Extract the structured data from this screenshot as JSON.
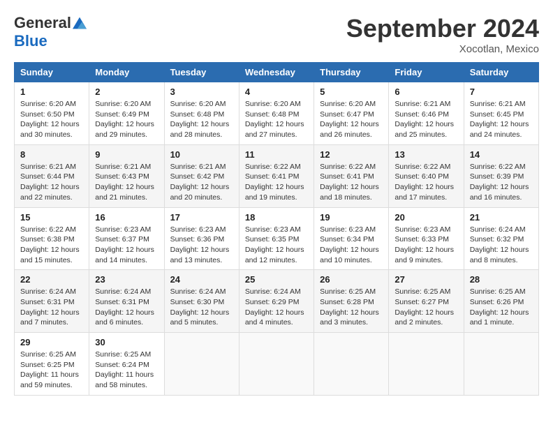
{
  "header": {
    "logo_general": "General",
    "logo_blue": "Blue",
    "month_title": "September 2024",
    "location": "Xocotlan, Mexico"
  },
  "weekdays": [
    "Sunday",
    "Monday",
    "Tuesday",
    "Wednesday",
    "Thursday",
    "Friday",
    "Saturday"
  ],
  "weeks": [
    [
      {
        "day": "1",
        "sunrise": "Sunrise: 6:20 AM",
        "sunset": "Sunset: 6:50 PM",
        "daylight": "Daylight: 12 hours and 30 minutes."
      },
      {
        "day": "2",
        "sunrise": "Sunrise: 6:20 AM",
        "sunset": "Sunset: 6:49 PM",
        "daylight": "Daylight: 12 hours and 29 minutes."
      },
      {
        "day": "3",
        "sunrise": "Sunrise: 6:20 AM",
        "sunset": "Sunset: 6:48 PM",
        "daylight": "Daylight: 12 hours and 28 minutes."
      },
      {
        "day": "4",
        "sunrise": "Sunrise: 6:20 AM",
        "sunset": "Sunset: 6:48 PM",
        "daylight": "Daylight: 12 hours and 27 minutes."
      },
      {
        "day": "5",
        "sunrise": "Sunrise: 6:20 AM",
        "sunset": "Sunset: 6:47 PM",
        "daylight": "Daylight: 12 hours and 26 minutes."
      },
      {
        "day": "6",
        "sunrise": "Sunrise: 6:21 AM",
        "sunset": "Sunset: 6:46 PM",
        "daylight": "Daylight: 12 hours and 25 minutes."
      },
      {
        "day": "7",
        "sunrise": "Sunrise: 6:21 AM",
        "sunset": "Sunset: 6:45 PM",
        "daylight": "Daylight: 12 hours and 24 minutes."
      }
    ],
    [
      {
        "day": "8",
        "sunrise": "Sunrise: 6:21 AM",
        "sunset": "Sunset: 6:44 PM",
        "daylight": "Daylight: 12 hours and 22 minutes."
      },
      {
        "day": "9",
        "sunrise": "Sunrise: 6:21 AM",
        "sunset": "Sunset: 6:43 PM",
        "daylight": "Daylight: 12 hours and 21 minutes."
      },
      {
        "day": "10",
        "sunrise": "Sunrise: 6:21 AM",
        "sunset": "Sunset: 6:42 PM",
        "daylight": "Daylight: 12 hours and 20 minutes."
      },
      {
        "day": "11",
        "sunrise": "Sunrise: 6:22 AM",
        "sunset": "Sunset: 6:41 PM",
        "daylight": "Daylight: 12 hours and 19 minutes."
      },
      {
        "day": "12",
        "sunrise": "Sunrise: 6:22 AM",
        "sunset": "Sunset: 6:41 PM",
        "daylight": "Daylight: 12 hours and 18 minutes."
      },
      {
        "day": "13",
        "sunrise": "Sunrise: 6:22 AM",
        "sunset": "Sunset: 6:40 PM",
        "daylight": "Daylight: 12 hours and 17 minutes."
      },
      {
        "day": "14",
        "sunrise": "Sunrise: 6:22 AM",
        "sunset": "Sunset: 6:39 PM",
        "daylight": "Daylight: 12 hours and 16 minutes."
      }
    ],
    [
      {
        "day": "15",
        "sunrise": "Sunrise: 6:22 AM",
        "sunset": "Sunset: 6:38 PM",
        "daylight": "Daylight: 12 hours and 15 minutes."
      },
      {
        "day": "16",
        "sunrise": "Sunrise: 6:23 AM",
        "sunset": "Sunset: 6:37 PM",
        "daylight": "Daylight: 12 hours and 14 minutes."
      },
      {
        "day": "17",
        "sunrise": "Sunrise: 6:23 AM",
        "sunset": "Sunset: 6:36 PM",
        "daylight": "Daylight: 12 hours and 13 minutes."
      },
      {
        "day": "18",
        "sunrise": "Sunrise: 6:23 AM",
        "sunset": "Sunset: 6:35 PM",
        "daylight": "Daylight: 12 hours and 12 minutes."
      },
      {
        "day": "19",
        "sunrise": "Sunrise: 6:23 AM",
        "sunset": "Sunset: 6:34 PM",
        "daylight": "Daylight: 12 hours and 10 minutes."
      },
      {
        "day": "20",
        "sunrise": "Sunrise: 6:23 AM",
        "sunset": "Sunset: 6:33 PM",
        "daylight": "Daylight: 12 hours and 9 minutes."
      },
      {
        "day": "21",
        "sunrise": "Sunrise: 6:24 AM",
        "sunset": "Sunset: 6:32 PM",
        "daylight": "Daylight: 12 hours and 8 minutes."
      }
    ],
    [
      {
        "day": "22",
        "sunrise": "Sunrise: 6:24 AM",
        "sunset": "Sunset: 6:31 PM",
        "daylight": "Daylight: 12 hours and 7 minutes."
      },
      {
        "day": "23",
        "sunrise": "Sunrise: 6:24 AM",
        "sunset": "Sunset: 6:31 PM",
        "daylight": "Daylight: 12 hours and 6 minutes."
      },
      {
        "day": "24",
        "sunrise": "Sunrise: 6:24 AM",
        "sunset": "Sunset: 6:30 PM",
        "daylight": "Daylight: 12 hours and 5 minutes."
      },
      {
        "day": "25",
        "sunrise": "Sunrise: 6:24 AM",
        "sunset": "Sunset: 6:29 PM",
        "daylight": "Daylight: 12 hours and 4 minutes."
      },
      {
        "day": "26",
        "sunrise": "Sunrise: 6:25 AM",
        "sunset": "Sunset: 6:28 PM",
        "daylight": "Daylight: 12 hours and 3 minutes."
      },
      {
        "day": "27",
        "sunrise": "Sunrise: 6:25 AM",
        "sunset": "Sunset: 6:27 PM",
        "daylight": "Daylight: 12 hours and 2 minutes."
      },
      {
        "day": "28",
        "sunrise": "Sunrise: 6:25 AM",
        "sunset": "Sunset: 6:26 PM",
        "daylight": "Daylight: 12 hours and 1 minute."
      }
    ],
    [
      {
        "day": "29",
        "sunrise": "Sunrise: 6:25 AM",
        "sunset": "Sunset: 6:25 PM",
        "daylight": "Daylight: 11 hours and 59 minutes."
      },
      {
        "day": "30",
        "sunrise": "Sunrise: 6:25 AM",
        "sunset": "Sunset: 6:24 PM",
        "daylight": "Daylight: 11 hours and 58 minutes."
      },
      null,
      null,
      null,
      null,
      null
    ]
  ]
}
